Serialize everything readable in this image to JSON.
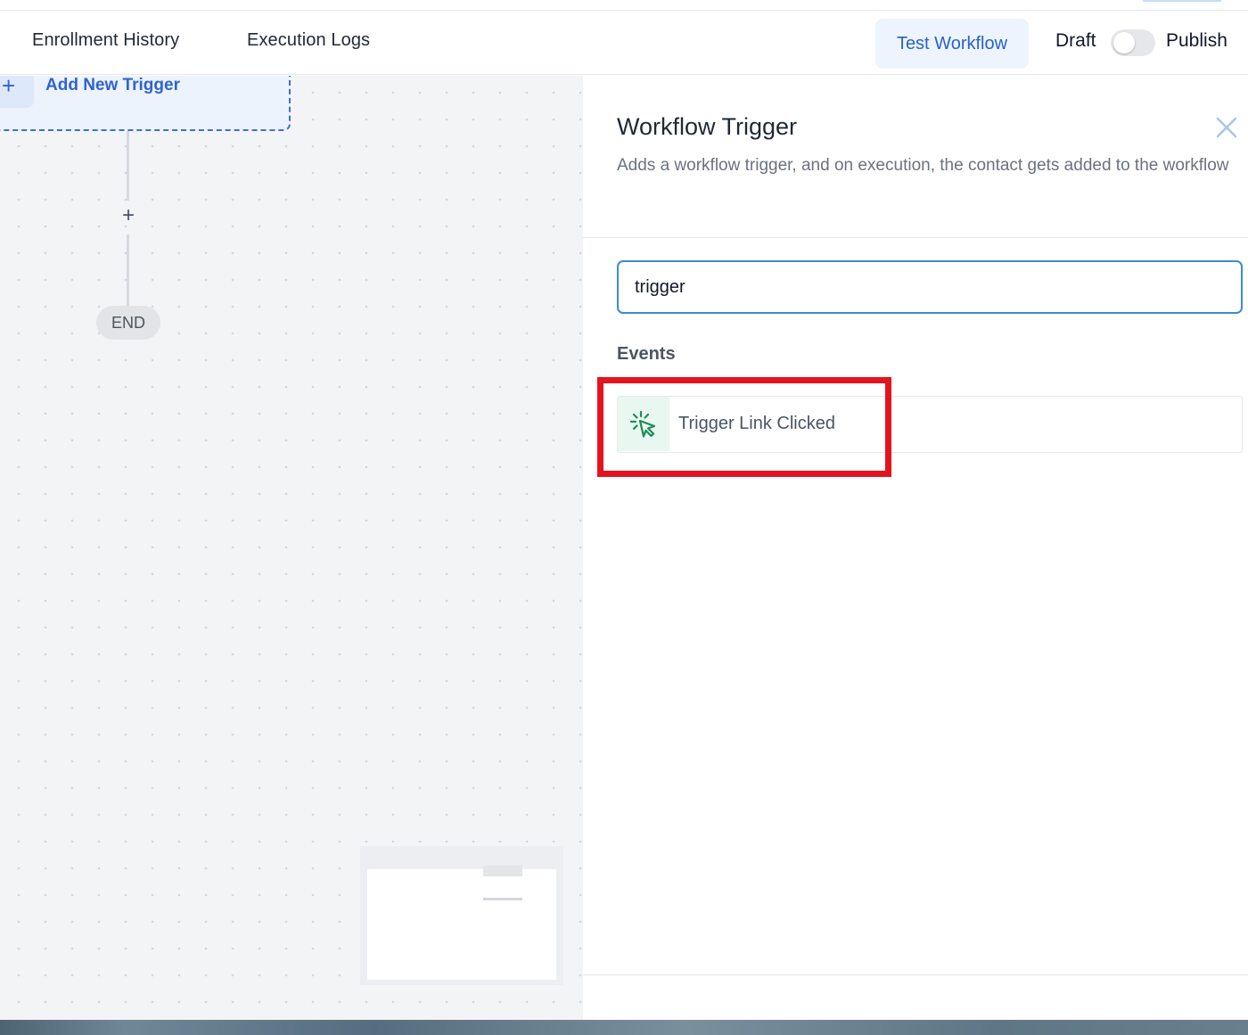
{
  "header": {
    "tabs": [
      {
        "label": "Enrollment History"
      },
      {
        "label": "Execution Logs"
      }
    ],
    "test_workflow_label": "Test Workflow",
    "draft_label": "Draft",
    "publish_label": "Publish",
    "publish_toggle_on": false
  },
  "canvas": {
    "add_trigger_label": "Add New Trigger",
    "add_step_symbol": "+",
    "end_label": "END"
  },
  "panel": {
    "title": "Workflow Trigger",
    "description": "Adds a workflow trigger, and on execution, the contact gets added to the workflow",
    "search_value": "trigger",
    "section_label": "Events",
    "events": [
      {
        "label": "Trigger Link Clicked",
        "icon": "cursor-click-icon"
      }
    ]
  },
  "colors": {
    "accent": "#2563c9",
    "event_icon": "#1f8a5b",
    "highlight": "#e3141e"
  }
}
